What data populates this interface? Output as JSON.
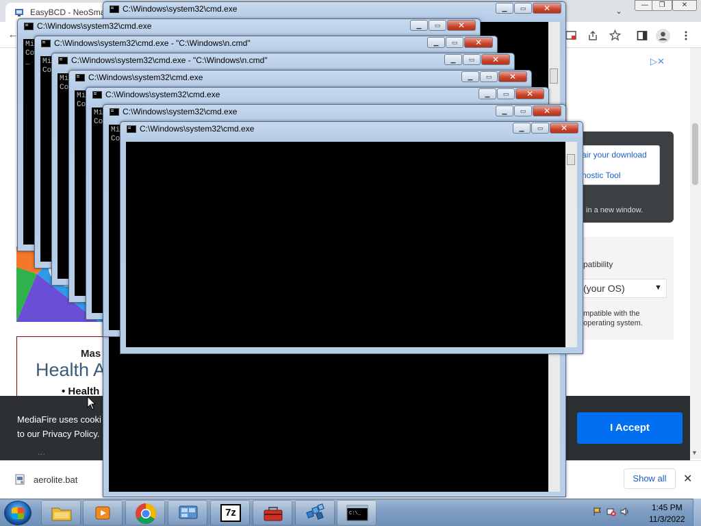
{
  "browser": {
    "tab_title": "EasyBCD - NeoSmar",
    "tab_dropdown": "⌄",
    "back_icon": "←",
    "window_controls": {
      "minimize": "—",
      "maximize": "❐",
      "close": "✕"
    },
    "toolbar_icons": [
      "install-icon",
      "share-icon",
      "bookmark-star-icon",
      "sidebar-icon",
      "profile-icon",
      "menu-icon"
    ]
  },
  "page": {
    "ad_close": "▷✕",
    "download_links": [
      "air your download",
      "nostic Tool"
    ],
    "download_note": "in a new window.",
    "compat_title": "patibility",
    "os_select_value": "(your OS)",
    "compat_note_1": "mpatible with the",
    "compat_note_2": "operating system.",
    "health_mas": "Mas",
    "health_title": "Health A",
    "health_bullet": "• Health"
  },
  "cookie_bar": {
    "text_line_1": "MediaFire uses cooki",
    "text_line_2": "to our Privacy Policy.",
    "text_line_3": "...",
    "accept_label": "I Accept"
  },
  "download_shelf": {
    "file_name": "aerolite.bat",
    "show_all_label": "Show all",
    "close_label": "✕"
  },
  "cmd_windows": [
    {
      "title": "C:\\Windows\\system32\\cmd.exe",
      "body_lines": []
    },
    {
      "title": "C:\\Windows\\system32\\cmd.exe",
      "body_lines": [
        "Mi",
        "Co",
        "_"
      ]
    },
    {
      "title": "C:\\Windows\\system32\\cmd.exe - \"C:\\Windows\\n.cmd\"",
      "body_lines": [
        "Mi",
        "Co"
      ]
    },
    {
      "title": "C:\\Windows\\system32\\cmd.exe - \"C:\\Windows\\n.cmd\"",
      "body_lines": [
        "Mi",
        "Co"
      ]
    },
    {
      "title": "C:\\Windows\\system32\\cmd.exe",
      "body_lines": [
        "Mi",
        "Co"
      ]
    },
    {
      "title": "C:\\Windows\\system32\\cmd.exe",
      "body_lines": [
        "Mi",
        "Co"
      ]
    },
    {
      "title": "C:\\Windows\\system32\\cmd.exe",
      "body_lines": [
        "Mi",
        "Co"
      ]
    },
    {
      "title": "C:\\Windows\\system32\\cmd.exe",
      "body_lines": []
    }
  ],
  "cmd_buttons": {
    "minimize": "▁",
    "maximize": "▭",
    "close": "✕"
  },
  "taskbar": {
    "pinned": [
      "file-explorer-icon",
      "media-player-icon",
      "chrome-icon",
      "control-panel-icon",
      "7zip-icon",
      "toolbox-icon",
      "registry-editor-icon",
      "cmd-icon"
    ],
    "sevenzip_label": "7z",
    "clock_time": "1:45 PM",
    "clock_date": "11/3/2022"
  }
}
